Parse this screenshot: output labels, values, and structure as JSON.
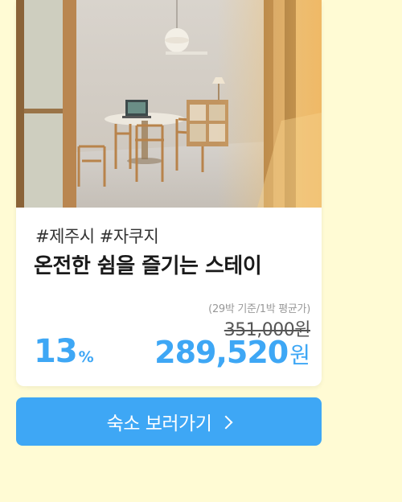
{
  "card": {
    "image_alt": "숙소 내부 사진",
    "tags": "#제주시 #자쿠지",
    "title": "온전한 쉼을 즐기는 스테이",
    "discount": {
      "value": "13",
      "unit": "%"
    },
    "price": {
      "note": "(29박 기준/1박 평균가)",
      "original": "351,000원",
      "final_value": "289,520",
      "final_unit": "원"
    }
  },
  "cta": {
    "label": "숙소 보러가기",
    "icon": "chevron-right-icon"
  },
  "colors": {
    "background": "#fffbd4",
    "accent": "#3ea7f5",
    "card": "#ffffff"
  }
}
